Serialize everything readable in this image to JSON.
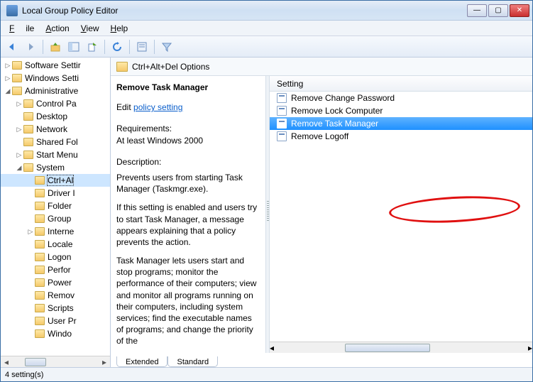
{
  "window": {
    "title": "Local Group Policy Editor"
  },
  "menu": {
    "file": "File",
    "action": "Action",
    "view": "View",
    "help": "Help"
  },
  "tree": {
    "items": [
      {
        "level": 1,
        "expander": "▷",
        "label": "Software Settir"
      },
      {
        "level": 1,
        "expander": "▷",
        "label": "Windows Setti"
      },
      {
        "level": 1,
        "expander": "◢",
        "label": "Administrative"
      },
      {
        "level": 2,
        "expander": "▷",
        "label": "Control Pa"
      },
      {
        "level": 2,
        "expander": "",
        "label": "Desktop"
      },
      {
        "level": 2,
        "expander": "▷",
        "label": "Network"
      },
      {
        "level": 2,
        "expander": "",
        "label": "Shared Fol"
      },
      {
        "level": 2,
        "expander": "▷",
        "label": "Start Menu"
      },
      {
        "level": 2,
        "expander": "◢",
        "label": "System"
      },
      {
        "level": 3,
        "expander": "",
        "label": "Ctrl+Al",
        "selected": true
      },
      {
        "level": 3,
        "expander": "",
        "label": "Driver I"
      },
      {
        "level": 3,
        "expander": "",
        "label": "Folder"
      },
      {
        "level": 3,
        "expander": "",
        "label": "Group"
      },
      {
        "level": 3,
        "expander": "▷",
        "label": "Interne"
      },
      {
        "level": 3,
        "expander": "",
        "label": "Locale"
      },
      {
        "level": 3,
        "expander": "",
        "label": "Logon"
      },
      {
        "level": 3,
        "expander": "",
        "label": "Perfor"
      },
      {
        "level": 3,
        "expander": "",
        "label": "Power"
      },
      {
        "level": 3,
        "expander": "",
        "label": "Remov"
      },
      {
        "level": 3,
        "expander": "",
        "label": "Scripts"
      },
      {
        "level": 3,
        "expander": "",
        "label": "User Pr"
      },
      {
        "level": 3,
        "expander": "",
        "label": "Windo"
      }
    ]
  },
  "header": {
    "path": "Ctrl+Alt+Del Options"
  },
  "detail": {
    "title": "Remove Task Manager",
    "edit_label": "Edit",
    "link": "policy setting",
    "req_label": "Requirements:",
    "req_text": "At least Windows 2000",
    "desc_label": "Description:",
    "desc_p1": "Prevents users from starting Task Manager (Taskmgr.exe).",
    "desc_p2": "If this setting is enabled and users try to start Task Manager, a message appears explaining that a policy prevents the action.",
    "desc_p3": "Task Manager lets users start and stop programs; monitor the performance of their computers; view and monitor all programs running on their computers, including system services; find the executable names of programs; and change the priority of the"
  },
  "list": {
    "column": "Setting",
    "items": [
      {
        "label": "Remove Change Password"
      },
      {
        "label": "Remove Lock Computer"
      },
      {
        "label": "Remove Task Manager",
        "selected": true
      },
      {
        "label": "Remove Logoff"
      }
    ]
  },
  "tabs": {
    "extended": "Extended",
    "standard": "Standard"
  },
  "status": {
    "text": "4 setting(s)"
  }
}
